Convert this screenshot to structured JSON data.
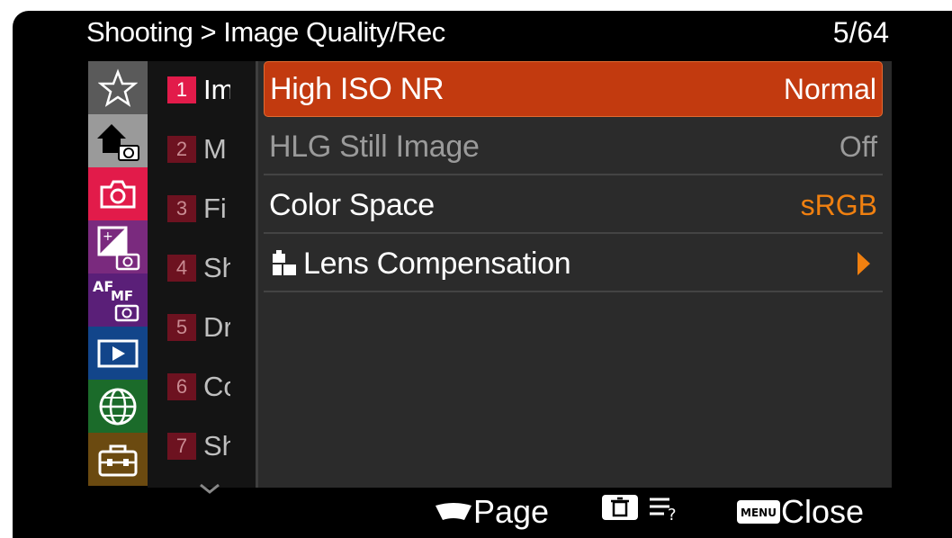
{
  "header": {
    "breadcrumb": "Shooting > Image Quality/Rec",
    "page_indicator": "5/64"
  },
  "tabs": [
    {
      "icon": "star-icon",
      "color": "#5a5a5a"
    },
    {
      "icon": "home-camera-icon",
      "color": "#9a9a9a"
    },
    {
      "icon": "camera-icon",
      "color": "#e21b4a"
    },
    {
      "icon": "exposure-camera-icon",
      "color": "#7a2a7e"
    },
    {
      "icon": "af-mf-camera-icon",
      "color": "#5a1f78"
    },
    {
      "icon": "playback-icon",
      "color": "#12458a"
    },
    {
      "icon": "globe-icon",
      "color": "#1b6b2a"
    },
    {
      "icon": "toolbox-icon",
      "color": "#6b4a10"
    }
  ],
  "submenu": [
    {
      "num": "1",
      "text": "Im"
    },
    {
      "num": "2",
      "text": "M"
    },
    {
      "num": "3",
      "text": "Fi"
    },
    {
      "num": "4",
      "text": "Sh"
    },
    {
      "num": "5",
      "text": "Dr"
    },
    {
      "num": "6",
      "text": "Co"
    },
    {
      "num": "7",
      "text": "Sh"
    }
  ],
  "menu": {
    "items": [
      {
        "label": "High ISO NR",
        "value": "Normal"
      },
      {
        "label": "HLG Still Image",
        "value": "Off"
      },
      {
        "label": "Color Space",
        "value": "sRGB"
      },
      {
        "label": "Lens Compensation",
        "value": ""
      }
    ]
  },
  "footer": {
    "page_label": "Page",
    "close_label": "Close",
    "menu_button_text": "MENU"
  },
  "colors": {
    "accent_selected": "#c23a0f",
    "value_orange": "#f08010",
    "camera_tab": "#e21b4a"
  }
}
